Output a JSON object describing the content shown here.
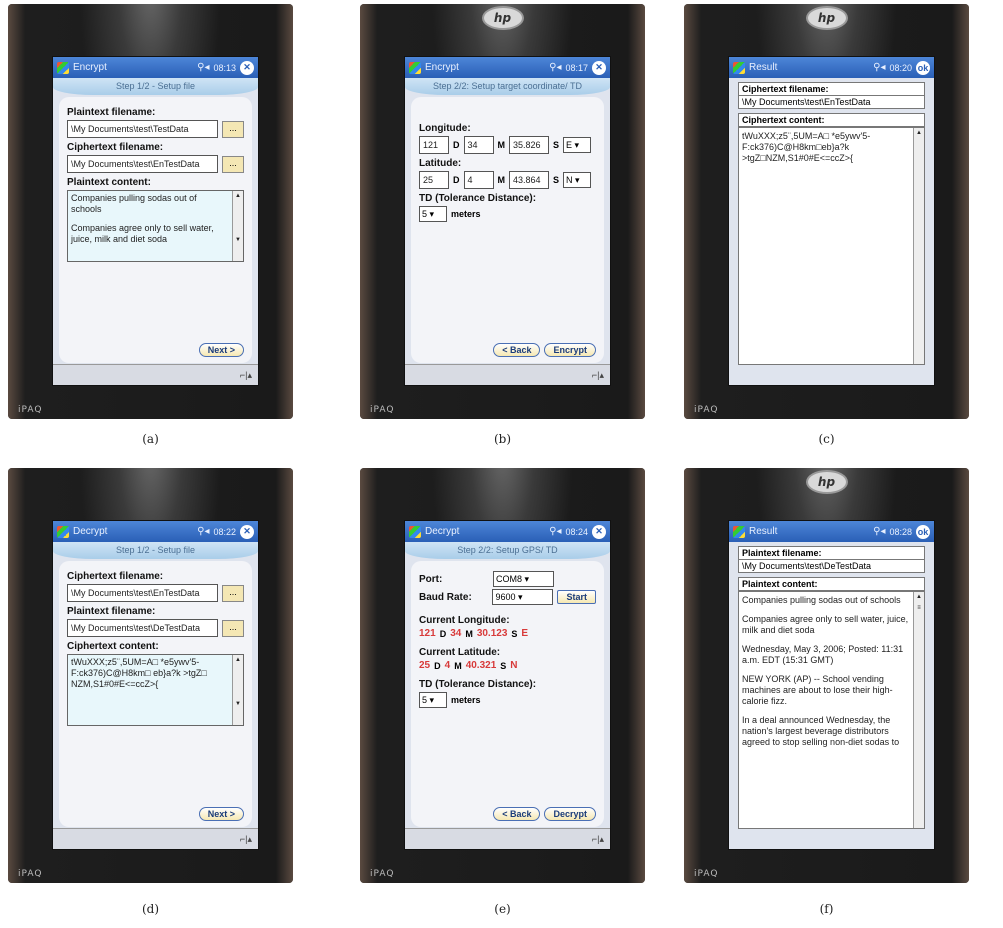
{
  "common": {
    "brand": "iPAQ",
    "dots": "...",
    "sip": "⌐|▴"
  },
  "a": {
    "caption": "(a)",
    "title": "Encrypt",
    "clock": "08:13",
    "step": "Step 1/2 - Setup file",
    "plain_label": "Plaintext filename:",
    "plain_value": "\\My Documents\\test\\TestData",
    "cipher_label": "Ciphertext filename:",
    "cipher_value": "\\My Documents\\test\\EnTestData",
    "content_label": "Plaintext content:",
    "content_p1": "Companies pulling sodas out of schools",
    "content_p2": "Companies agree only to sell water, juice, milk and diet soda",
    "next": "Next >"
  },
  "b": {
    "caption": "(b)",
    "title": "Encrypt",
    "clock": "08:17",
    "step": "Step 2/2: Setup target coordinate/ TD",
    "lon_label": "Longitude:",
    "lon_d": "121",
    "lon_m": "34",
    "lon_s": "35.826",
    "lon_dir": "E",
    "lat_label": "Latitude:",
    "lat_d": "25",
    "lat_m": "4",
    "lat_s": "43.864",
    "lat_dir": "N",
    "unit_d": "D",
    "unit_m": "M",
    "unit_s": "S",
    "td_label": "TD (Tolerance Distance):",
    "td_value": "5",
    "meters": "meters",
    "back": "< Back",
    "encrypt": "Encrypt"
  },
  "c": {
    "caption": "(c)",
    "title": "Result",
    "clock": "08:20",
    "ok": "ok",
    "file_label": "Ciphertext filename:",
    "file_value": "\\My Documents\\test\\EnTestData",
    "content_label": "Ciphertext content:",
    "content": "tWuXXX;z5¨,5UM=A□ *e5ywv'5-F:ck376)C@H8km□eb}a?k >tgZ□NZM,S1#0#E<=ccZ>{"
  },
  "d": {
    "caption": "(d)",
    "title": "Decrypt",
    "clock": "08:22",
    "step": "Step 1/2 - Setup file",
    "cipher_label": "Ciphertext filename:",
    "cipher_value": "\\My Documents\\test\\EnTestData",
    "plain_label": "Plaintext filename:",
    "plain_value": "\\My Documents\\test\\DeTestData",
    "content_label": "Ciphertext content:",
    "content": "tWuXXX;z5¨,5UM=A□ *e5ywv'5-F:ck376)C@H8km□ eb}a?k >tgZ□ NZM,S1#0#E<=ccZ>{",
    "next": "Next >"
  },
  "e": {
    "caption": "(e)",
    "title": "Decrypt",
    "clock": "08:24",
    "step": "Step 2/2: Setup GPS/ TD",
    "port_label": "Port:",
    "port_value": "COM8",
    "baud_label": "Baud Rate:",
    "baud_value": "9600",
    "start": "Start",
    "cur_lon_label": "Current Longitude:",
    "lon_d": "121",
    "lon_m": "34",
    "lon_s": "30.123",
    "lon_dir": "E",
    "cur_lat_label": "Current Latitude:",
    "lat_d": "25",
    "lat_m": "4",
    "lat_s": "40.321",
    "lat_dir": "N",
    "unit_d": "D",
    "unit_m": "M",
    "unit_s": "S",
    "td_label": "TD (Tolerance Distance):",
    "td_value": "5",
    "meters": "meters",
    "back": "< Back",
    "decrypt": "Decrypt"
  },
  "f": {
    "caption": "(f)",
    "title": "Result",
    "clock": "08:28",
    "ok": "ok",
    "file_label": "Plaintext filename:",
    "file_value": "\\My Documents\\test\\DeTestData",
    "content_label": "Plaintext content:",
    "p1": "Companies pulling sodas out of schools",
    "p2": "Companies agree only to sell water, juice, milk and diet soda",
    "p3": "Wednesday, May 3, 2006; Posted: 11:31 a.m. EDT (15:31 GMT)",
    "p4": "NEW YORK (AP) -- School vending machines are about to lose their high-calorie fizz.",
    "p5": "In a deal announced Wednesday, the nation's largest beverage distributors agreed to stop selling non-diet sodas to"
  }
}
